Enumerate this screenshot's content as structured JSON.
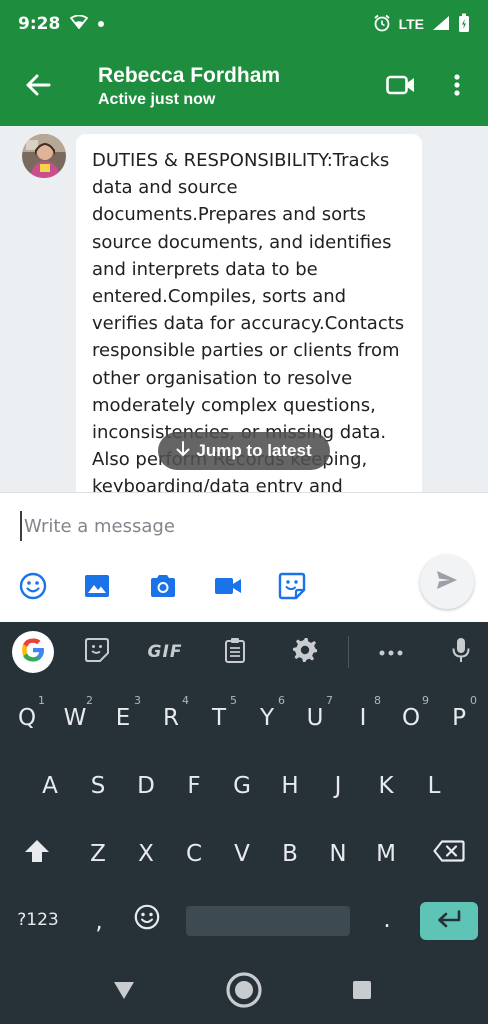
{
  "status_bar": {
    "time": "9:28",
    "network": "LTE"
  },
  "header": {
    "contact_name": "Rebecca Fordham",
    "contact_status": "Active just now",
    "icons": [
      "back-arrow-icon",
      "video-call-icon",
      "overflow-menu-icon"
    ]
  },
  "conversation": {
    "message_text": "DUTIES & RESPONSIBILITY:Tracks data and source documents.Prepares and sorts source documents, and identifies and interprets data to be entered.Compiles, sorts and verifies data for accuracy.Contacts responsible parties or clients from other organisation to resolve moderately complex questions, inconsistencies, or missing data. Also perform Records keeping, keyboarding/data entry and",
    "jump_label": "Jump to latest"
  },
  "compose": {
    "placeholder": "Write a message",
    "tools": [
      "emoji-icon",
      "image-icon",
      "camera-icon",
      "video-icon",
      "sticker-icon"
    ]
  },
  "keyboard": {
    "gif_label": "GIF",
    "row1": [
      {
        "key": "Q",
        "hint": "1"
      },
      {
        "key": "W",
        "hint": "2"
      },
      {
        "key": "E",
        "hint": "3"
      },
      {
        "key": "R",
        "hint": "4"
      },
      {
        "key": "T",
        "hint": "5"
      },
      {
        "key": "Y",
        "hint": "6"
      },
      {
        "key": "U",
        "hint": "7"
      },
      {
        "key": "I",
        "hint": "8"
      },
      {
        "key": "O",
        "hint": "9"
      },
      {
        "key": "P",
        "hint": "0"
      }
    ],
    "row2": [
      "A",
      "S",
      "D",
      "F",
      "G",
      "H",
      "J",
      "K",
      "L"
    ],
    "row3": [
      "Z",
      "X",
      "C",
      "V",
      "B",
      "N",
      "M"
    ],
    "sym_label": "?123",
    "comma": ",",
    "period": "."
  },
  "colors": {
    "brand_green": "#1e8e3e",
    "keyboard_bg": "#263238",
    "enter_key": "#5ec4b6",
    "conversation_bg": "#eceff1"
  }
}
